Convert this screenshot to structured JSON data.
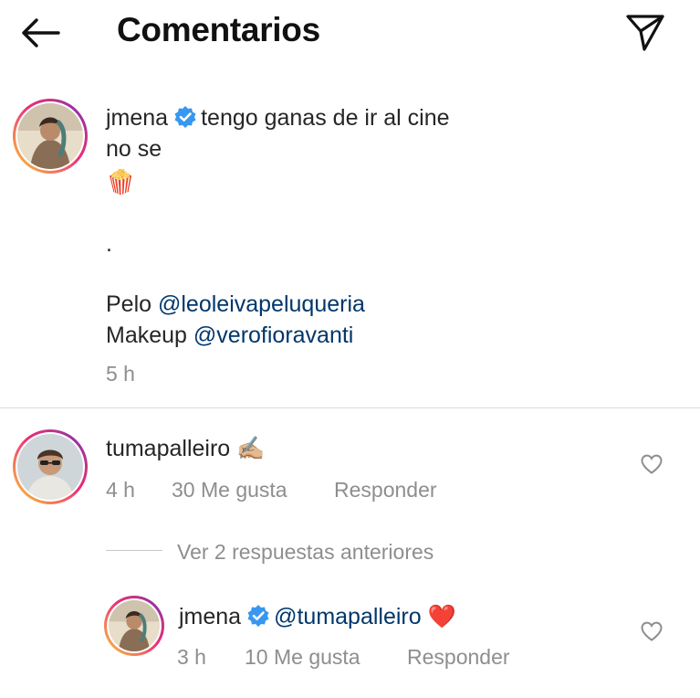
{
  "header": {
    "title": "Comentarios"
  },
  "caption": {
    "username": "jmena",
    "text_line1": "tengo ganas de ir al cine",
    "text_line2": "no se",
    "emoji": "🍿",
    "dot": ".",
    "pelo_label": "Pelo",
    "pelo_mention": "@leoleivapeluqueria",
    "makeup_label": "Makeup",
    "makeup_mention": "@verofioravanti",
    "time": "5 h"
  },
  "comment": {
    "username": "tumapalleiro",
    "emoji": "✍🏼",
    "time": "4 h",
    "likes": "30 Me gusta",
    "reply_label": "Responder",
    "view_replies": "Ver 2 respuestas anteriores"
  },
  "reply": {
    "username": "jmena",
    "mention": "@tumapalleiro",
    "emoji": "❤️",
    "time": "3 h",
    "likes": "10 Me gusta",
    "reply_label": "Responder"
  },
  "colors": {
    "mention": "#00376b",
    "verified": "#3897f0",
    "meta": "#8e8e8e",
    "heart": "#ed4956"
  }
}
